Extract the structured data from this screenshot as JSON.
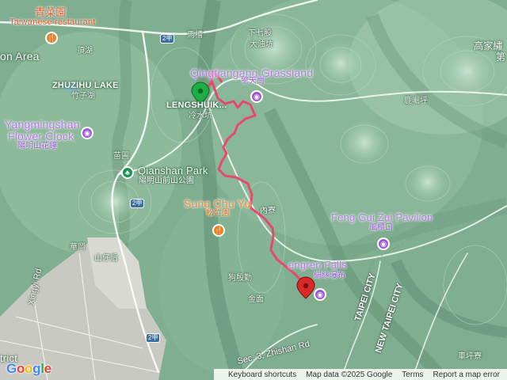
{
  "map": {
    "provider_logo": "Google",
    "attribution": {
      "shortcuts": "Keyboard shortcuts",
      "map_data": "Map data ©2025 Google",
      "terms": "Terms",
      "report": "Report a map error"
    },
    "labels": {
      "qingcaiyuan_cn": "青菜園",
      "taiwanese_restaurant": "Taiwanese restaurant",
      "on_area": "on Area",
      "dinghu": "頂湖",
      "zhuzihu_lake": "ZHUZIHU LAKE",
      "zhuzihu_cn": "竹子湖",
      "yangmingshan_clock_en_1": "Yangmingshan",
      "yangmingshan_clock_en_2": "Flower Clock",
      "yangmingshan_clock_cn": "陽明山花鐘",
      "miaopu": "苗圃",
      "qianshan_park_en": "Qianshan Park",
      "qianshan_park_cn": "陽明山前山公園",
      "macao": "馬槽",
      "xiaqigu": "下七股",
      "dayoukeng": "大油坑",
      "qingtiangang_en": "Qingtiangang Grassland",
      "qingtiangang_cn": "擎天崗",
      "lengshuikeng_en": "LENGSHUIK...",
      "lengshuikeng_cn": "冷水坑",
      "sung_chu_yuan_en": "Sung Chu Yu",
      "sung_chu_yuan_cn": "松竹園",
      "feng_gui_zui_en": "Feng Gui Zui Pavilion",
      "feng_gui_zui_cn": "風櫃口",
      "neiliao": "內寮",
      "juesi_falls_en": "Juesi...Falls",
      "juesi_falls_en_vis": "engren Falls",
      "juesi_falls_cn": "絹絲瀑布",
      "gouyingqin": "狗殷勤",
      "jinmian": "金面",
      "huagang": "華岡",
      "shanzaihou": "山仔后",
      "xingyi_rd": "Xingyi Rd",
      "taipei_city": "TAIPEI CITY",
      "new_taipei_city": "NEW TAIPEI CITY",
      "chepingliao": "車坪寮",
      "gaojiajiao": "高家繡",
      "gaojiajiao_suffix": "第",
      "lujuping": "鹿崛坪",
      "district_partial": "trict",
      "zhishan_rd": "Sec. 3, Zhishan Rd",
      "road_2jia": "2甲",
      "road_2": "2甲",
      "road_2jia_b": "2甲",
      "road_2p": "2甲",
      "sec_label": "Se",
      "yangde_rd": "ng Rd",
      "cut_left": "on Area"
    },
    "icons": {
      "restaurant_pin": "fork-knife-icon",
      "park_pin": "tree-icon",
      "attraction_pin": "camera-icon",
      "start_marker": "green-marker-icon",
      "end_marker": "red-marker-icon"
    },
    "colors": {
      "terrain": "#7fae90",
      "route": "#e8496a",
      "attraction": "#a056d8",
      "park": "#159550",
      "restaurant": "#f0801e",
      "city": "#c9c9c4"
    }
  }
}
